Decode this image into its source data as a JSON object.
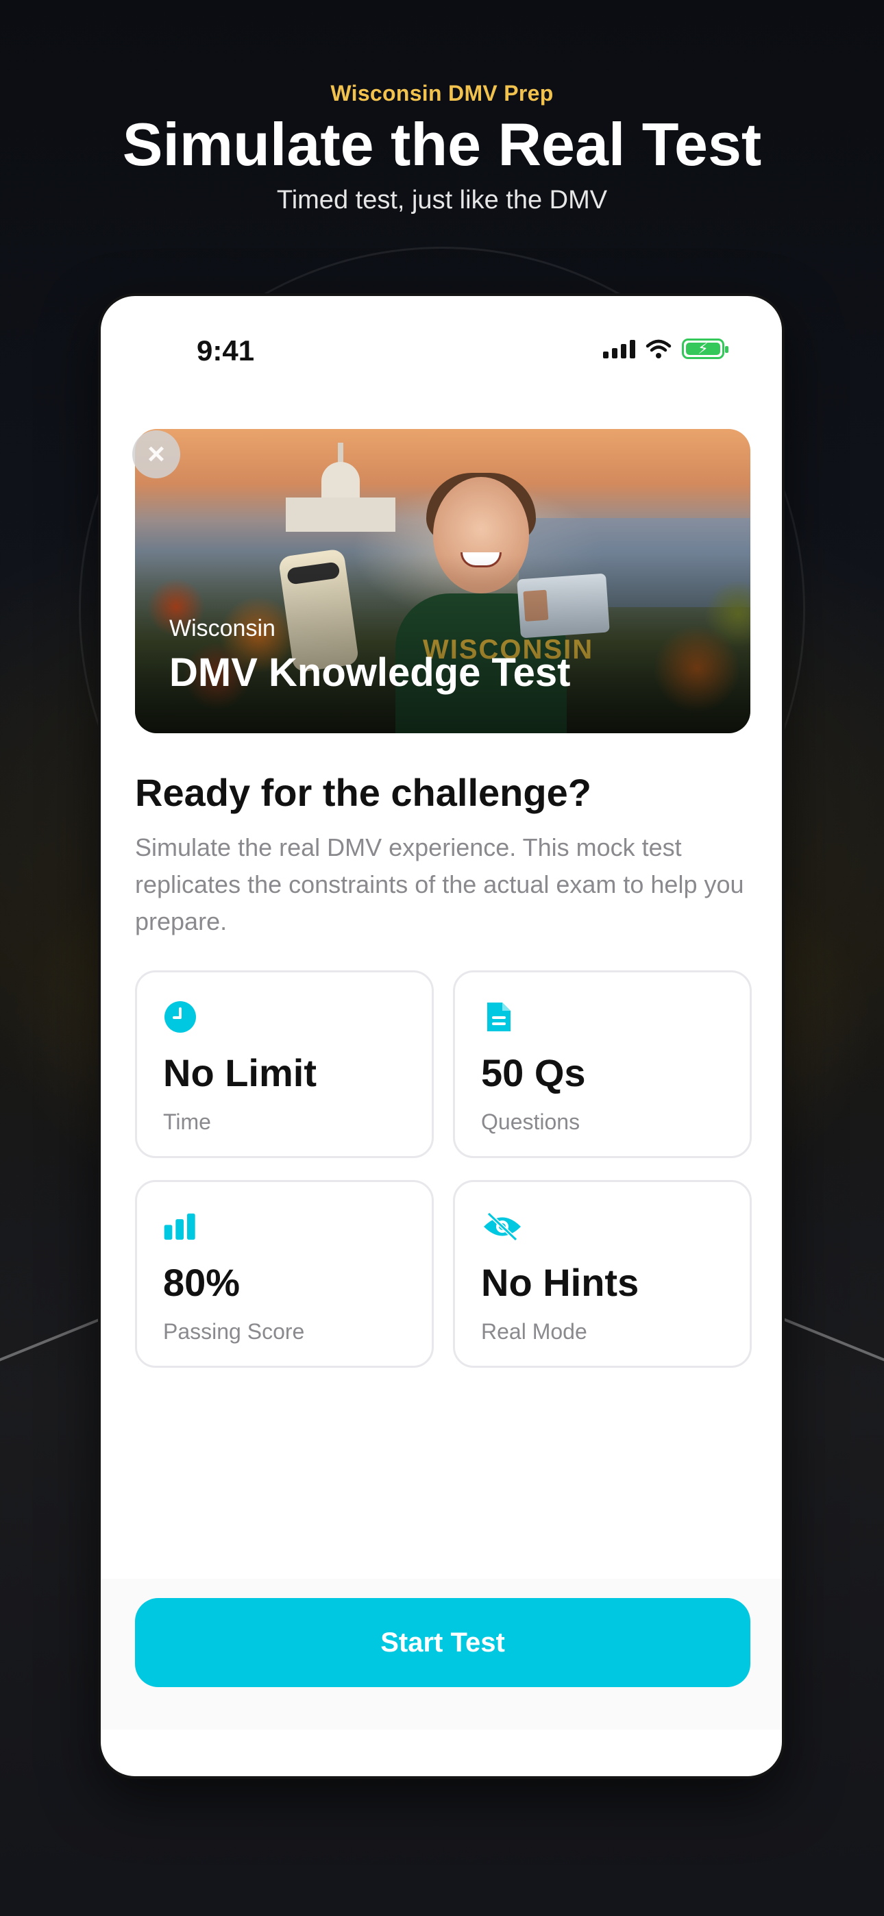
{
  "header": {
    "eyebrow": "Wisconsin DMV Prep",
    "title": "Simulate the Real Test",
    "subtitle": "Timed test, just like the DMV"
  },
  "status_bar": {
    "time": "9:41"
  },
  "hero": {
    "kicker": "Wisconsin",
    "title": "DMV Knowledge Test"
  },
  "intro": {
    "title": "Ready for the challenge?",
    "description": "Simulate the real DMV experience. This mock test replicates the constraints of the actual exam to help you prepare."
  },
  "stats": [
    {
      "icon": "clock-icon",
      "value": "No Limit",
      "label": "Time"
    },
    {
      "icon": "document-icon",
      "value": "50 Qs",
      "label": "Questions"
    },
    {
      "icon": "bar-chart-icon",
      "value": "80%",
      "label": "Passing Score"
    },
    {
      "icon": "eye-off-icon",
      "value": "No Hints",
      "label": "Real Mode"
    }
  ],
  "cta": {
    "start_label": "Start Test"
  },
  "colors": {
    "accent": "#00C8E0",
    "eyebrow": "#F2C24E",
    "battery": "#34C759"
  }
}
